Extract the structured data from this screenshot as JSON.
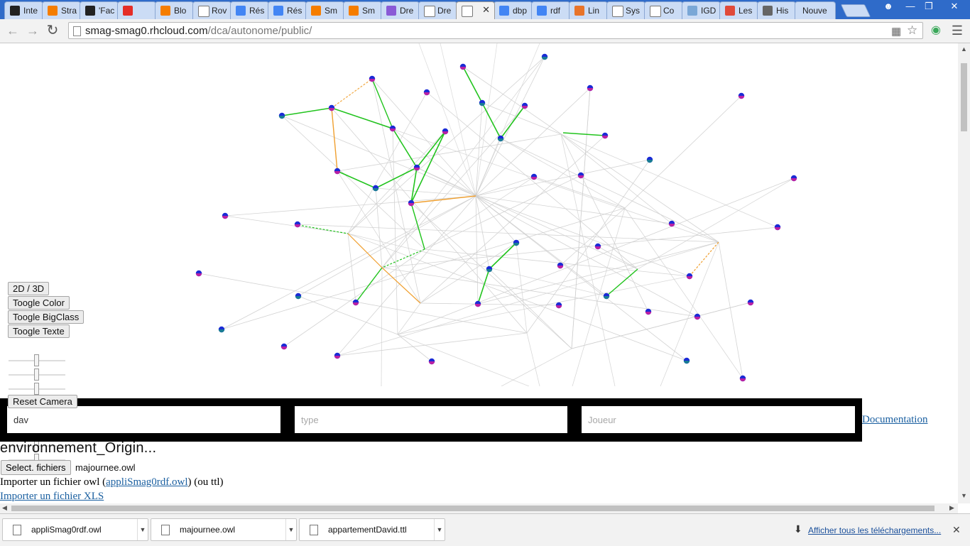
{
  "browser": {
    "tabs": [
      {
        "label": "Inte",
        "icon": "institution-icon",
        "color": "#222222"
      },
      {
        "label": "Stra",
        "icon": "blogger-icon",
        "color": "#f57d00"
      },
      {
        "label": "'Fac",
        "icon": "institution-icon",
        "color": "#222222"
      },
      {
        "label": "",
        "icon": "youtube-icon",
        "color": "#e52d27"
      },
      {
        "label": "Blo",
        "icon": "blogger-icon",
        "color": "#f57d00"
      },
      {
        "label": "Rov",
        "icon": "page-icon",
        "color": "#ffffff"
      },
      {
        "label": "Rés",
        "icon": "google-icon",
        "color": "#4285f4"
      },
      {
        "label": "Rés",
        "icon": "google-icon",
        "color": "#4285f4"
      },
      {
        "label": "Sm",
        "icon": "blogger-icon",
        "color": "#f57d00"
      },
      {
        "label": "Sm",
        "icon": "blogger-icon",
        "color": "#f57d00"
      },
      {
        "label": "Dre",
        "icon": "doc-icon",
        "color": "#8a5ad6"
      },
      {
        "label": "Dre",
        "icon": "page-icon",
        "color": "#ffffff"
      },
      {
        "label": "",
        "icon": "page-icon",
        "color": "#ffffff",
        "active": true
      },
      {
        "label": "dbp",
        "icon": "google-icon",
        "color": "#4285f4"
      },
      {
        "label": "rdf",
        "icon": "google-icon",
        "color": "#4285f4"
      },
      {
        "label": "Lin",
        "icon": "grid-icon",
        "color": "#e8742a"
      },
      {
        "label": "Sys",
        "icon": "wikipedia-icon",
        "color": "#ffffff"
      },
      {
        "label": "Co",
        "icon": "wikipedia-icon",
        "color": "#ffffff"
      },
      {
        "label": "IGD",
        "icon": "chart-icon",
        "color": "#7aa7d6"
      },
      {
        "label": "Les",
        "icon": "pinwheel-icon",
        "color": "#e04a3a"
      },
      {
        "label": "His",
        "icon": "history-icon",
        "color": "#666666"
      },
      {
        "label": "Nouve",
        "icon": "",
        "color": ""
      }
    ],
    "url_host": "smag-smag0.rhcloud.com",
    "url_path": "/dca/autonome/public/"
  },
  "controls": {
    "btn_2d3d": "2D / 3D",
    "btn_color": "Toogle Color",
    "btn_bigclass": "Toogle BigClass",
    "btn_texte": "Toogle Texte",
    "btn_reset": "Reset Camera",
    "slider_levels": [
      0.5,
      0.5,
      0.5,
      0.5,
      0.5,
      0.5,
      0.5,
      0.5
    ]
  },
  "search": {
    "field1_value": "dav",
    "field2_placeholder": "type",
    "field3_placeholder": "Joueur",
    "doc_link": "Documentation"
  },
  "ontology": {
    "title": "environnement_Origin...",
    "file_button": "Select. fichiers",
    "file_name": "majournee.owl",
    "import_owl_prefix": "Importer un fichier owl (",
    "import_owl_link": "appliSmag0rdf.owl",
    "import_owl_suffix": ") (ou ttl)",
    "import_xls": "Importer un fichier XLS"
  },
  "downloads": {
    "items": [
      "appliSmag0rdf.owl",
      "majournee.owl",
      "appartementDavid.ttl"
    ],
    "show_all": "Afficher tous les téléchargements..."
  },
  "colors": {
    "edge_gray": "#cfcfcf",
    "edge_green": "#22c41e",
    "edge_orange": "#f0a030",
    "node_blue": "#1a2bd6",
    "node_magenta": "#d6209a",
    "node_teal": "#1a8a8a",
    "tabstrip": "#2f6bc9",
    "link": "#1a5fa0"
  }
}
